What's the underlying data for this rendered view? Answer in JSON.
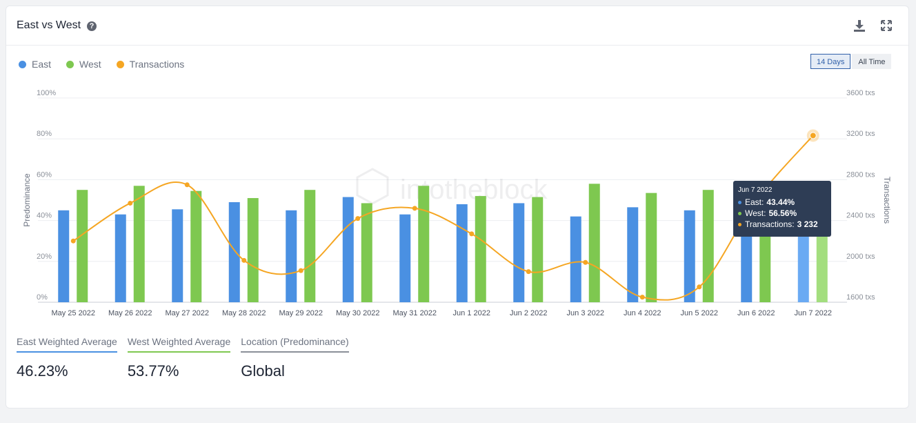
{
  "header": {
    "title": "East vs West",
    "help_icon": "question-circle-icon",
    "download_icon": "download-icon",
    "expand_icon": "expand-icon"
  },
  "range": {
    "options": [
      "14 Days",
      "All Time"
    ],
    "selected": "14 Days"
  },
  "watermark": "intotheblock",
  "colors": {
    "east": "#4a90e2",
    "west": "#7ec850",
    "transactions": "#f5a623",
    "accent": "#2f5fa9"
  },
  "tooltip": {
    "date": "Jun 7 2022",
    "east_label": "East:",
    "east_value": "43.44%",
    "west_label": "West:",
    "west_value": "56.56%",
    "tx_label": "Transactions:",
    "tx_value": "3 232"
  },
  "stats": [
    {
      "label": "East Weighted Average",
      "value": "46.23%",
      "color": "#4a90e2"
    },
    {
      "label": "West Weighted Average",
      "value": "53.77%",
      "color": "#7ec850"
    },
    {
      "label": "Location (Predominance)",
      "value": "Global",
      "color": "#8a8f98"
    }
  ],
  "chart_data": {
    "type": "bar",
    "categories": [
      "May 25 2022",
      "May 26 2022",
      "May 27 2022",
      "May 28 2022",
      "May 29 2022",
      "May 30 2022",
      "May 31 2022",
      "Jun 1 2022",
      "Jun 2 2022",
      "Jun 3 2022",
      "Jun 4 2022",
      "Jun 5 2022",
      "Jun 6 2022",
      "Jun 7 2022"
    ],
    "series": [
      {
        "name": "East",
        "type": "bar",
        "axis": "left",
        "values": [
          45,
          43,
          45.5,
          49,
          45,
          51.5,
          43,
          48,
          48.5,
          42,
          46.5,
          45,
          44,
          43.44
        ]
      },
      {
        "name": "West",
        "type": "bar",
        "axis": "left",
        "values": [
          55,
          57,
          54.5,
          51,
          55,
          48.5,
          57,
          52,
          51.5,
          58,
          53.5,
          55,
          56,
          56.56
        ]
      },
      {
        "name": "Transactions",
        "type": "line",
        "axis": "right",
        "values": [
          2200,
          2570,
          2750,
          2010,
          1910,
          2420,
          2520,
          2270,
          1900,
          1990,
          1650,
          1750,
          2600,
          3232
        ]
      }
    ],
    "yleft": {
      "label": "Predominance",
      "ticks": [
        "0%",
        "20%",
        "40%",
        "60%",
        "80%",
        "100%"
      ],
      "lim": [
        0,
        100
      ]
    },
    "yright": {
      "label": "Transactions",
      "ticks": [
        "1600 txs",
        "2000 txs",
        "2400 txs",
        "2800 txs",
        "3200 txs",
        "3600 txs"
      ],
      "lim": [
        1600,
        3600
      ]
    },
    "legend": [
      "East",
      "West",
      "Transactions"
    ],
    "legend_position": "top-left",
    "grid": true,
    "highlighted_category": "Jun 7 2022"
  }
}
